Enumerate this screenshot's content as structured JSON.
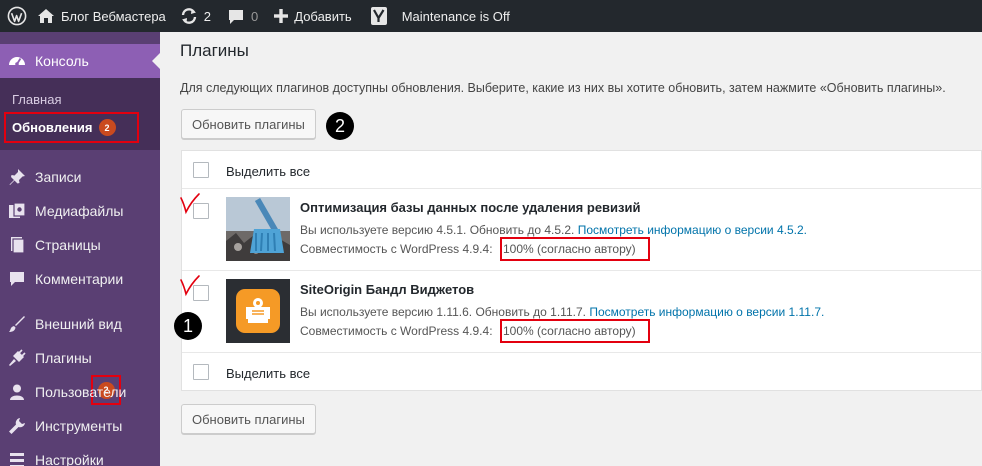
{
  "adminbar": {
    "logo_icon": "wordpress-icon",
    "site_name": "Блог Вебмастера",
    "updates_count": "2",
    "comments_count": "0",
    "add_new": "Добавить",
    "yoast_icon": "yoast-icon",
    "maintenance": "Maintenance is Off"
  },
  "sidebar": {
    "console": "Консоль",
    "home": "Главная",
    "updates": "Обновления",
    "updates_badge": "2",
    "items": [
      {
        "label": "Записи",
        "icon": "pin-icon"
      },
      {
        "label": "Медиафайлы",
        "icon": "media-icon"
      },
      {
        "label": "Страницы",
        "icon": "pages-icon"
      },
      {
        "label": "Комментарии",
        "icon": "comment-icon"
      },
      {
        "label": "Внешний вид",
        "icon": "brush-icon"
      },
      {
        "label": "Плагины",
        "icon": "plugin-icon"
      },
      {
        "label": "Пользователи",
        "icon": "user-icon"
      },
      {
        "label": "Инструменты",
        "icon": "wrench-icon"
      },
      {
        "label": "Настройки",
        "icon": "settings-icon"
      }
    ],
    "plugins_badge": "2"
  },
  "main": {
    "title": "Плагины",
    "intro": "Для следующих плагинов доступны обновления. Выберите, какие из них вы хотите обновить, затем нажмите «Обновить плагины».",
    "update_button": "Обновить плагины",
    "select_all": "Выделить все",
    "plugins": [
      {
        "name": "Оптимизация базы данных после удаления ревизий",
        "version_text": "Вы используете версию 4.5.1. Обновить до 4.5.2.",
        "version_link": "Посмотреть информацию о версии 4.5.2.",
        "compat_prefix": "Совместимость с WordPress 4.9.4:",
        "compat_value": "100% (согласно автору)"
      },
      {
        "name": "SiteOrigin Бандл Виджетов",
        "version_text": "Вы используете версию 1.11.6. Обновить до 1.11.7.",
        "version_link": "Посмотреть информацию о версии 1.11.7.",
        "compat_prefix": "Совместимость с WordPress 4.9.4:",
        "compat_value": "100% (согласно автору)"
      }
    ],
    "annotation_1": "1",
    "annotation_2": "2"
  },
  "colors": {
    "adminbar": "#23282d",
    "sidebar": "#5a3f73",
    "active_menu": "#8d5fb4",
    "badge": "#ca4a1f",
    "link": "#0073aa",
    "highlight": "#e3000f"
  }
}
